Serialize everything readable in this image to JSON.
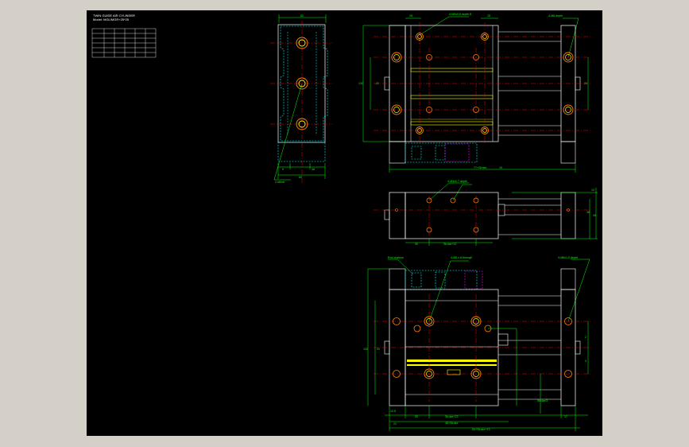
{
  "title_block": {
    "line1": "TWIN GUIDE AIR CYLINDER",
    "line2": "Model: MGL/MGR+25*25"
  },
  "spec_table": {
    "rows": [
      [
        "",
        "",
        "",
        "",
        "",
        ""
      ],
      [
        "",
        "",
        "",
        "",
        "",
        ""
      ],
      [
        "",
        "",
        "",
        "",
        "",
        ""
      ],
      [
        "",
        "",
        "",
        "",
        "",
        ""
      ],
      [
        "",
        "",
        "",
        "",
        "",
        ""
      ],
      [
        "",
        "",
        "",
        "",
        "",
        ""
      ]
    ]
  },
  "dims": {
    "side_top": "52",
    "side_a": "9",
    "side_b": "38",
    "side_bottom": "60",
    "side_note_1": "2-M6x8",
    "side_note_2": "",
    "top_l": "15",
    "top_r": "15",
    "top_note_1": "4-M5x0.8 depth 8",
    "top_note_2": "4-M6 depth",
    "top_note_3": "",
    "top_side_l": "130",
    "top_side_r": "20",
    "top_side_r2": "20",
    "top_bottom": "77+Stroke",
    "top_bottom_r": "10",
    "mid_note_1": "4-M4x0.7 depth",
    "mid_note_2": "",
    "mid_note_3": "",
    "mid_bottom_l": "30",
    "mid_bottom_c": "Stroke+12",
    "mid_right_a": "10",
    "mid_right_b": "38",
    "mid_right_c": "45",
    "bot_note_1": "Rod cushion",
    "bot_note_2": "",
    "bot_note_3": "4-M5 x 8 through",
    "bot_note_4": "",
    "bot_note_5": "4-M6x1.0 depth",
    "bot_left": "130",
    "bot_left_2": "20",
    "bot_bottom_1": "30",
    "bot_bottom_2": "Stroke+13",
    "bot_bottom_3": "46+Stroke",
    "bot_bottom_4": "54+Stroke+13",
    "bot_bottom_5": "17",
    "bot_bottom_6": "12.5",
    "bot_bottom_7": "21",
    "bot_right_note": "Stroke/2",
    "bot_right_a": "2",
    "bot_right_b": "3"
  },
  "colors": {
    "canvas": "#000000",
    "frame": "#d4d0c8",
    "outline": "#ffffff",
    "dimension": "#00ff00",
    "centerline": "#ff0000",
    "hidden": "#00ffff",
    "hole": "#ffff00",
    "orange": "#ff8000",
    "magenta": "#ff00ff"
  }
}
